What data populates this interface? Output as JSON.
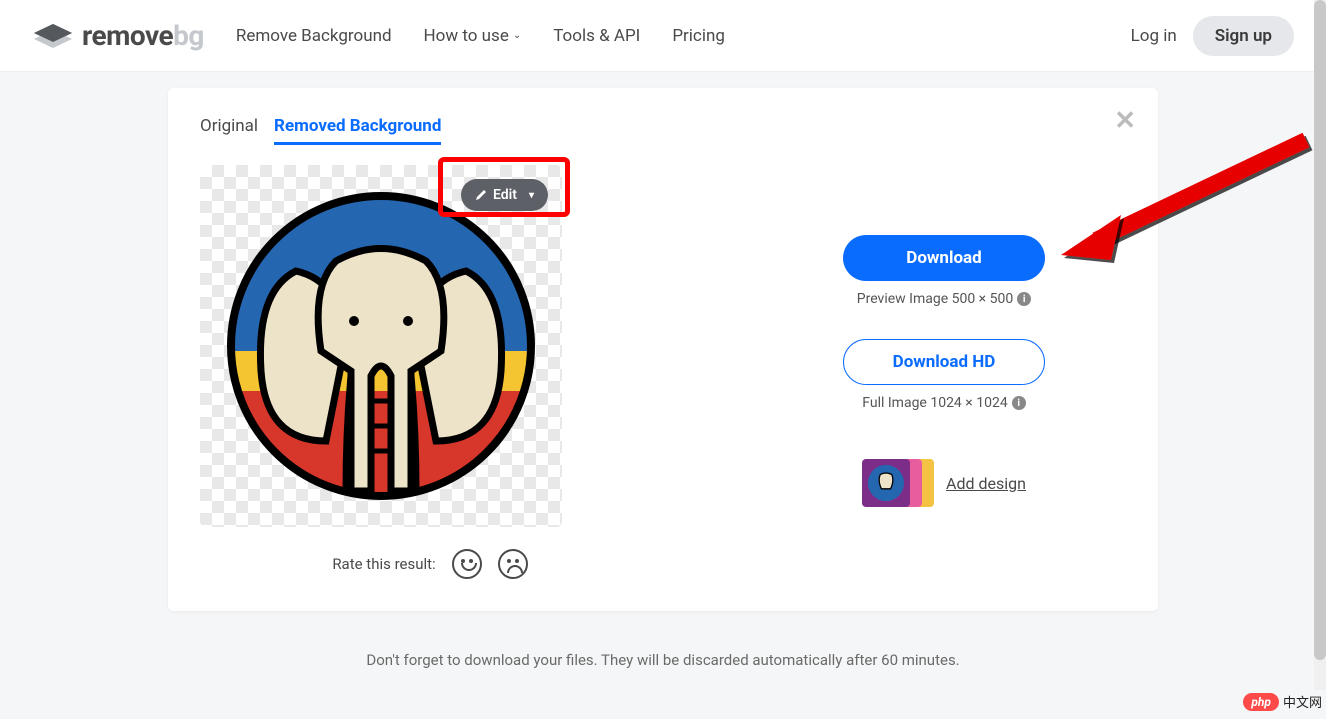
{
  "header": {
    "logo_text_main": "remove",
    "logo_text_suffix": "bg",
    "nav": {
      "remove_bg": "Remove Background",
      "how_to_use": "How to use",
      "tools_api": "Tools & API",
      "pricing": "Pricing"
    },
    "login": "Log in",
    "signup": "Sign up"
  },
  "tabs": {
    "original": "Original",
    "removed": "Removed Background"
  },
  "edit_button": "Edit",
  "rate_label": "Rate this result:",
  "download": {
    "button": "Download",
    "preview_meta": "Preview Image 500 × 500",
    "hd_button": "Download HD",
    "hd_meta": "Full Image 1024 × 1024"
  },
  "add_design": "Add design",
  "footer_note": "Don't forget to download your files. They will be discarded automatically after 60 minutes.",
  "watermark": {
    "badge": "php",
    "text": "中文网"
  }
}
